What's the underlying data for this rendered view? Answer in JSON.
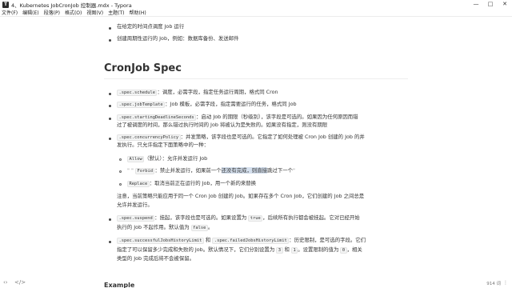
{
  "window": {
    "app_icon": "typora-icon",
    "title": "4、Kubernetes JobCronJob 控制器.mdx - Typora",
    "controls": [
      "—",
      "□",
      "✕"
    ]
  },
  "menu": [
    "文件(F)",
    "编辑(E)",
    "段落(P)",
    "格式(O)",
    "视图(V)",
    "主题(T)",
    "帮助(H)"
  ],
  "doc": {
    "top_items": [
      "在给定的时间点调度 Job 运行",
      "创建周期性运行的 Job，例如：数据库备份、发送邮件"
    ],
    "heading": "CronJob Spec",
    "schedule": {
      "code": ".spec.schedule",
      "text": "：调度，必需字段，指定任务运行周期，格式同 Cron"
    },
    "jobTemplate": {
      "code": ".spec.jobTemplate",
      "text": "：Job 模板，必需字段，指定需要运行的任务，格式同 Job"
    },
    "deadline": {
      "code": ".spec.startingDeadlineSeconds",
      "text1": "：启动 Job 的期限（秒级别），该字段是可选的。如果因为任何原因而错",
      "text2": "过了被调度的时间，那么错过执行时间的 Job 将被认为是失败的。如果没有指定，则没有期限"
    },
    "concurrency": {
      "code": ".spec.concurrencyPolicy",
      "text1": "：并发策略，该字段也是可选的。它指定了如何处理被 Cron Job 创建的 Job 的并",
      "text2": "发执行。只允许指定下面策略中的一种："
    },
    "policies": [
      {
        "code": "Allow",
        "text": "（默认）：允许并发运行 Job"
      },
      {
        "prefix": "\" \"",
        "code": "Forbid",
        "text_a": "：禁止并发运行，如果前一个",
        "text_sel": "还没有完成，则直接",
        "text_b": "跳过下一个",
        "suffix": "\""
      },
      {
        "code": "Replace",
        "text": "：取消当前正在运行的 Job，用一个新的来替换"
      }
    ],
    "note1": "注意，当前策略只能应用于同一个 Cron Job 创建的 Job。如果存在多个 Cron Job，它们创建的 Job 之间总是",
    "note2": "允许并发运行。",
    "suspend": {
      "code": ".spec.suspend",
      "text1": "：挂起，该字段也是可选的。如果设置为 ",
      "code2": "true",
      "text2": "，后续所有执行都会被挂起。它对已经开始",
      "text3": "执行的 Job 不起作用。默认值为 ",
      "code3": "false",
      "text4": "。"
    },
    "history": {
      "code": ".spec.successfulJobsHistoryLimit",
      "and": " 和 ",
      "code2": ".spec.failedJobsHistoryLimit",
      "text1": "：历史限制，是可选的字段。它们",
      "text2": "指定了可以保留多少完成和失败的 Job。默认情况下，它们分别设置为 ",
      "code3": "3",
      "text3": " 和 ",
      "code4": "1",
      "text4": "。设置限制的值为 ",
      "code5": "0",
      "text5": "，相关",
      "text6": "类型的 Job 完成后将不会被保留。"
    },
    "bottom_heading": "Example"
  },
  "status": {
    "left_icon": "‹›",
    "source_icon": "</>",
    "word_count": "914 词"
  }
}
